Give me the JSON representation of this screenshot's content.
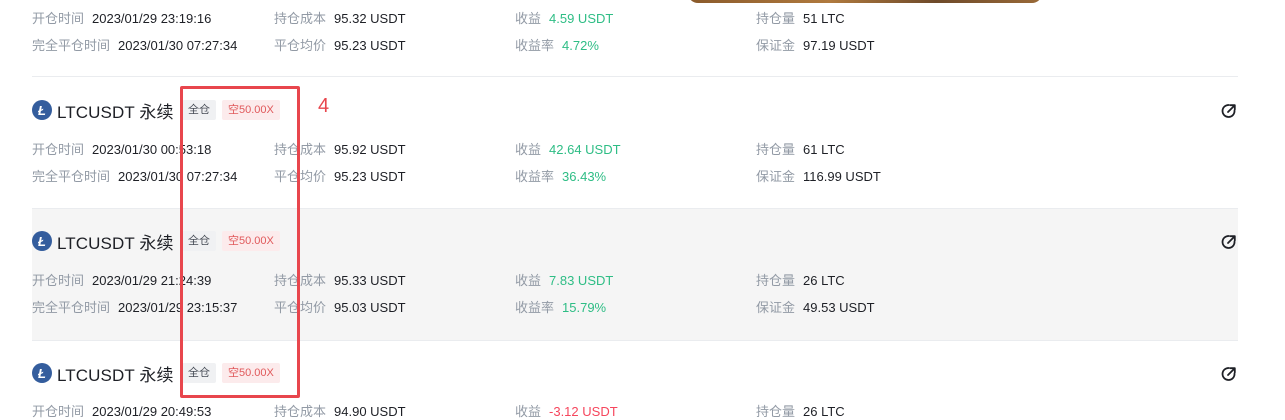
{
  "labels": {
    "open_time": "开仓时间",
    "close_time": "完全平仓时间",
    "cost": "持仓成本",
    "avg_close": "平仓均价",
    "pnl": "收益",
    "roi": "收益率",
    "qty": "持仓量",
    "margin": "保证金"
  },
  "annotation": {
    "marker": "4",
    "color": "#e8464d"
  },
  "colors": {
    "positive": "#2ebd85",
    "negative": "#f6465d",
    "coin": "#345d9d"
  },
  "cards": [
    {
      "symbol": "",
      "mode": "",
      "leverage": "",
      "open_time": "2023/01/29 23:19:16",
      "close_time": "2023/01/30 07:27:34",
      "cost": "95.32 USDT",
      "avg_close": "95.23 USDT",
      "pnl": "4.59 USDT",
      "roi": "4.72%",
      "qty": "51 LTC",
      "margin": "97.19 USDT"
    },
    {
      "symbol": "LTCUSDT 永续",
      "mode": "全仓",
      "leverage": "空50.00X",
      "open_time": "2023/01/30 00:53:18",
      "close_time": "2023/01/30 07:27:34",
      "cost": "95.92 USDT",
      "avg_close": "95.23 USDT",
      "pnl": "42.64 USDT",
      "roi": "36.43%",
      "qty": "61 LTC",
      "margin": "116.99 USDT"
    },
    {
      "symbol": "LTCUSDT 永续",
      "mode": "全仓",
      "leverage": "空50.00X",
      "open_time": "2023/01/29 21:24:39",
      "close_time": "2023/01/29 23:15:37",
      "cost": "95.33 USDT",
      "avg_close": "95.03 USDT",
      "pnl": "7.83 USDT",
      "roi": "15.79%",
      "qty": "26 LTC",
      "margin": "49.53 USDT"
    },
    {
      "symbol": "LTCUSDT 永续",
      "mode": "全仓",
      "leverage": "空50.00X",
      "open_time": "2023/01/29 20:49:53",
      "close_time": "",
      "cost": "94.90 USDT",
      "avg_close": "",
      "pnl": "-3.12 USDT",
      "roi": "",
      "qty": "26 LTC",
      "margin": ""
    }
  ]
}
